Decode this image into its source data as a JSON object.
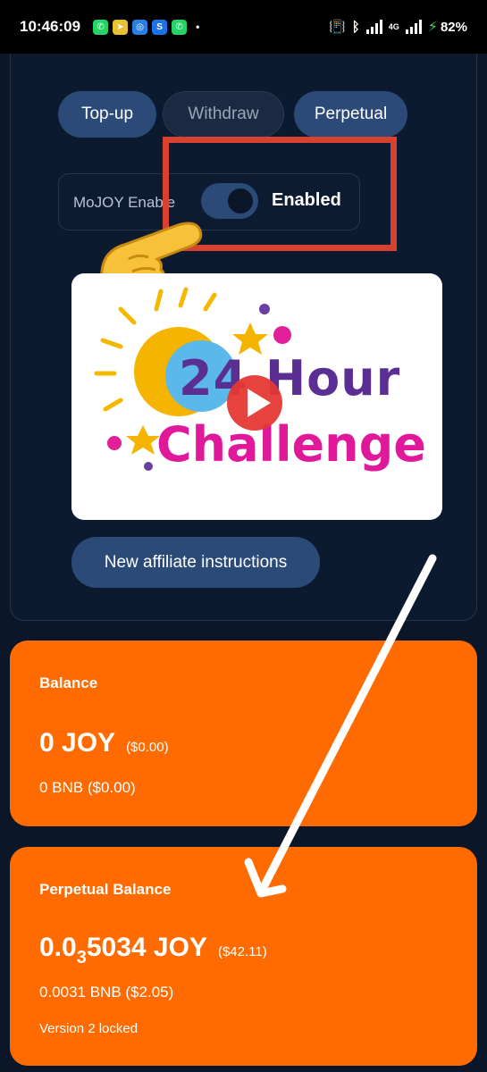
{
  "status_bar": {
    "time": "10:46:09",
    "dot": "•",
    "battery": "82%",
    "network": "4G",
    "notification_icons": [
      "whatsapp-icon",
      "telegram-icon",
      "browser-icon",
      "shazam-icon",
      "whatsapp-icon"
    ]
  },
  "tabs": {
    "topup": "Top-up",
    "withdraw": "Withdraw",
    "perpetual": "Perpetual"
  },
  "mojoy_toggle": {
    "label": "MoJOY Enable",
    "state": "Enabled",
    "enabled": true
  },
  "video": {
    "line1": "24 Hour",
    "line2": "Challenge"
  },
  "affiliate_button": "New affiliate instructions",
  "balance_card": {
    "title": "Balance",
    "joy_amount": "0 JOY",
    "joy_usd": "($0.00)",
    "bnb_line": "0 BNB  ($0.00)"
  },
  "perpetual_card": {
    "title": "Perpetual Balance",
    "amount_prefix": "0.0",
    "amount_subscript": "3",
    "amount_suffix": "5034 JOY",
    "usd": "($42.11)",
    "bnb_line": "0.0031 BNB  ($2.05)",
    "note": "Version 2 locked"
  },
  "colors": {
    "background": "#0b1628",
    "pill": "#2b4a78",
    "card_orange": "#ff6b00",
    "highlight_red": "#d7412f",
    "play_red": "#e53935"
  }
}
